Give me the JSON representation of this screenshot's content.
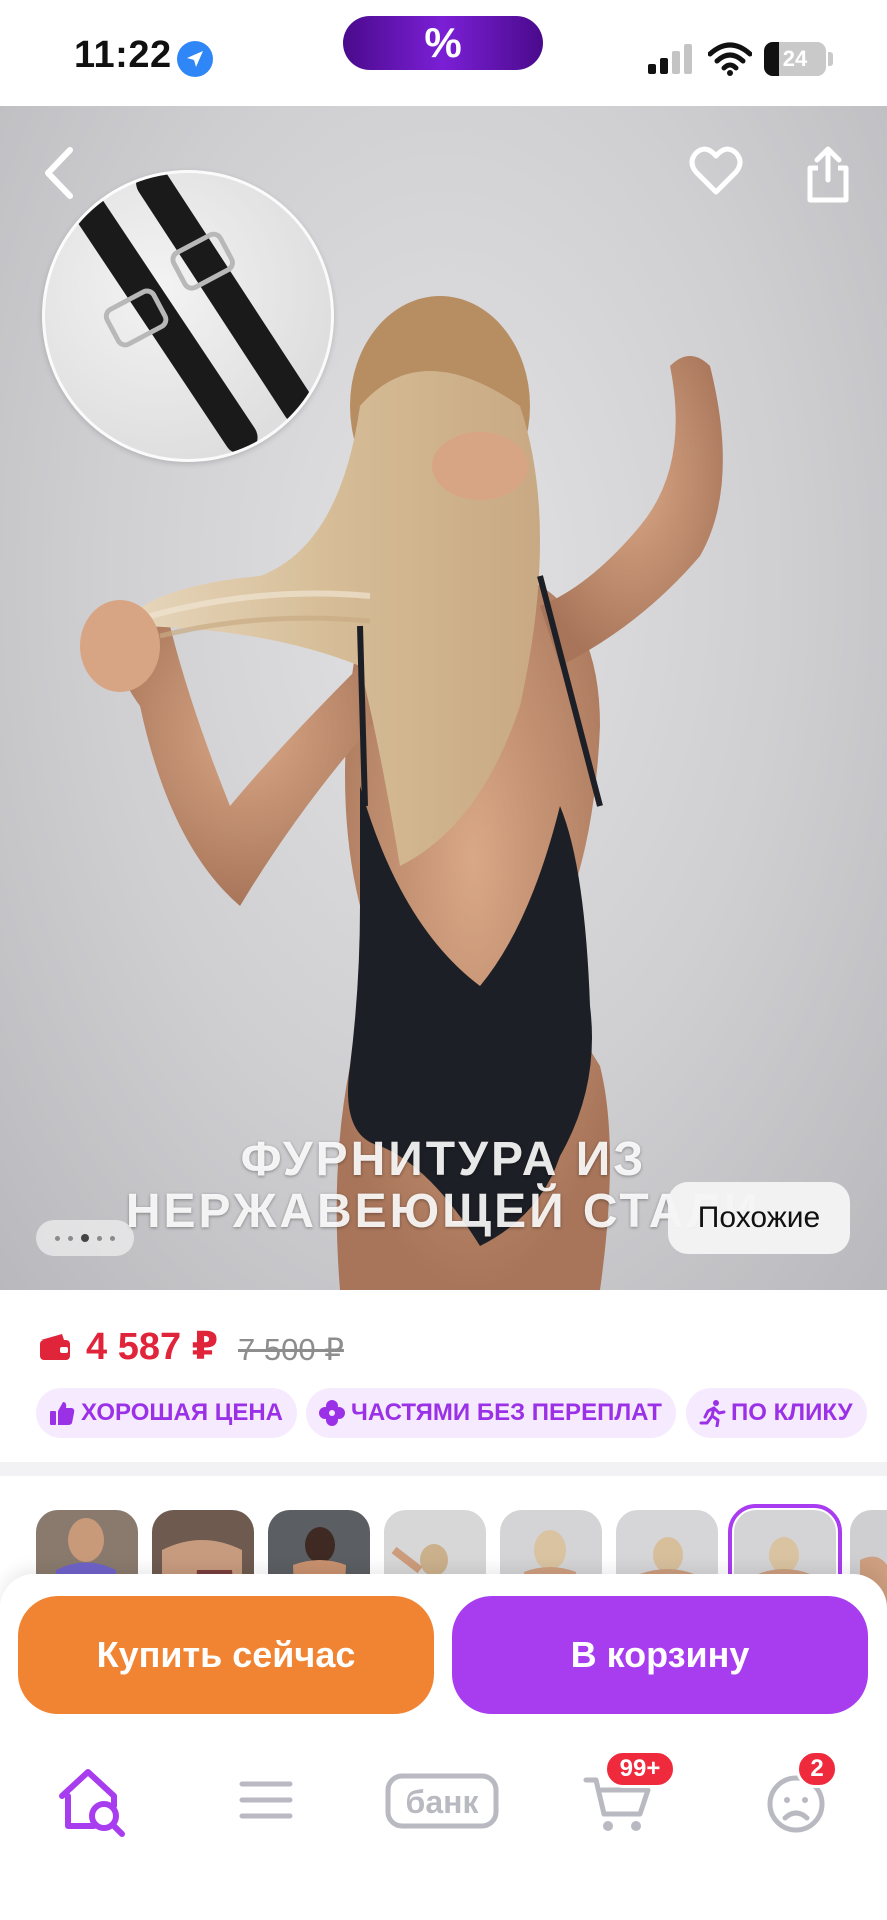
{
  "status_bar": {
    "time": "11:22",
    "battery": "24",
    "battery_level_percent": 24,
    "promo_symbol": "%",
    "icons": [
      "location-arrow-icon",
      "signal-icon",
      "wifi-icon",
      "battery-icon"
    ]
  },
  "hero": {
    "caption_line1": "ФУРНИТУРА ИЗ",
    "caption_line2": "НЕРЖАВЕЮЩЕЙ СТАЛИ",
    "similar_label": "Похожие",
    "image_count": 5,
    "active_image_index": 2,
    "icons": [
      "back-icon",
      "heart-icon",
      "share-icon"
    ]
  },
  "price": {
    "current": "4 587 ₽",
    "old": "7 500 ₽",
    "current_color": "#e0243a"
  },
  "badges": [
    {
      "label": "ХОРОШАЯ ЦЕНА",
      "icon": "thumbs-up-icon"
    },
    {
      "label": "ЧАСТЯМИ БЕЗ ПЕРЕПЛАТ",
      "icon": "clover-icon"
    },
    {
      "label": "ПО КЛИКУ",
      "icon": "running-icon"
    }
  ],
  "thumbnails": {
    "count": 8,
    "selected_index": 6
  },
  "actions": {
    "buy_now": "Купить сейчас",
    "add_to_cart": "В корзину",
    "buy_now_color": "#f08432",
    "add_to_cart_color": "#a83df0"
  },
  "bottom_nav": {
    "items": [
      {
        "name": "home",
        "icon": "home-search-icon",
        "active": true
      },
      {
        "name": "catalog",
        "icon": "menu-icon"
      },
      {
        "name": "bank",
        "label": "банк"
      },
      {
        "name": "cart",
        "icon": "cart-icon",
        "badge": "99+"
      },
      {
        "name": "profile",
        "icon": "profile-icon",
        "badge": "2"
      }
    ],
    "accent_color": "#a83df0"
  }
}
